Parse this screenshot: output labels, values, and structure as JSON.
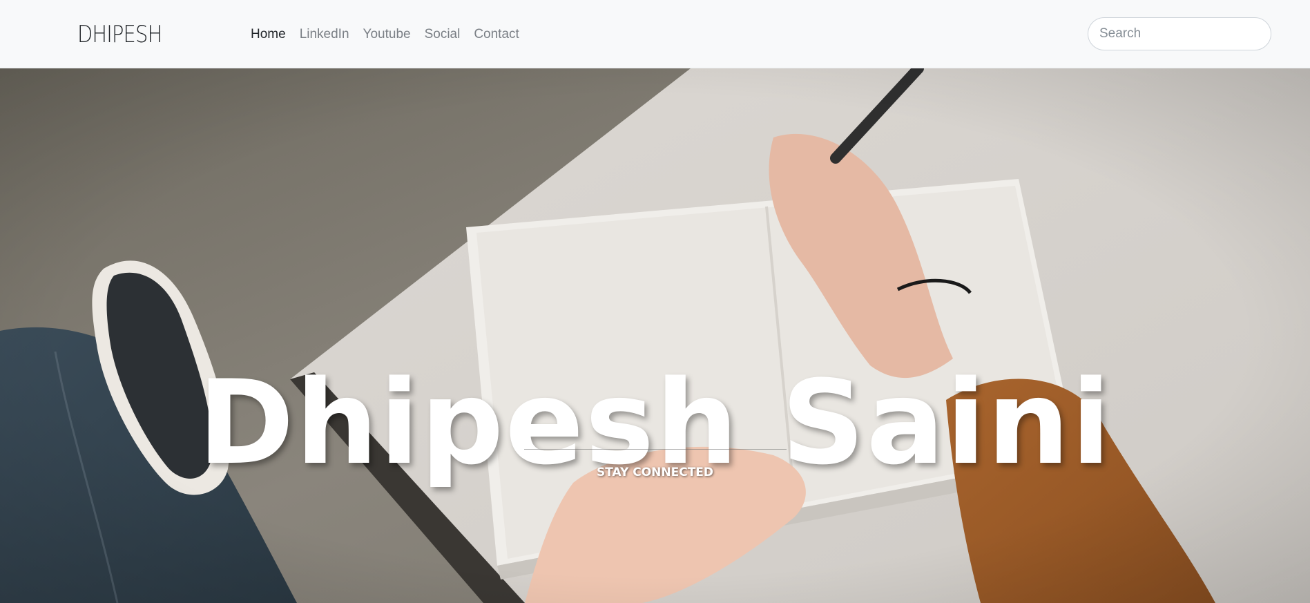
{
  "navbar": {
    "brand": "DHIPESH",
    "links": [
      {
        "label": "Home",
        "active": true
      },
      {
        "label": "LinkedIn",
        "active": false
      },
      {
        "label": "Youtube",
        "active": false
      },
      {
        "label": "Social",
        "active": false
      },
      {
        "label": "Contact",
        "active": false
      }
    ],
    "search": {
      "placeholder": "Search",
      "value": ""
    }
  },
  "hero": {
    "title": "Dhipesh Saini",
    "tagline": "STAY CONNECTED",
    "background_image": "person-writing-in-notebook-photo"
  },
  "colors": {
    "navbar_bg": "#f8f9fa",
    "nav_active": "#212529",
    "nav_link": "#7a7f85",
    "hero_text": "#ffffff"
  }
}
